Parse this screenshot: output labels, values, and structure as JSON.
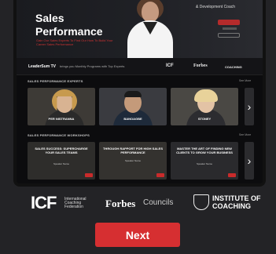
{
  "hero": {
    "title_line1": "Sales",
    "title_line2": "Performance",
    "subtitle": "& Development Coach",
    "description": "Gain Our Sales Experts To Find Our How To Build Your Career Sales Performance"
  },
  "partner_bar": {
    "brand": "LeaderSum TV",
    "tagline": "brings you Monthly Programs with Top Experts",
    "logos": [
      "ICF",
      "Forbes",
      "COACHING"
    ]
  },
  "experts": {
    "section_label": "SALES PERFORMANCE EXPERTS",
    "see_all": "See More",
    "cards": [
      {
        "name": "PER NISTRANNA"
      },
      {
        "name": "BANOAGBE"
      },
      {
        "name": "STONEY"
      }
    ]
  },
  "workshops": {
    "section_label": "SALES PERFORMANCE WORKSHOPS",
    "see_all": "See More",
    "cards": [
      {
        "title": "SALES SUCCESS: SUPERCHARGE YOUR SALES TEAMS",
        "sub": "Speaker Name"
      },
      {
        "title": "THROUGH RAPPORT FOR HIGH SALES PERFORMANCE",
        "sub": "Speaker Name"
      },
      {
        "title": "MASTER THE ART OF FINDING NEW CLIENTS TO GROW YOUR BUSINESS",
        "sub": "Speaker Name"
      }
    ]
  },
  "footer_logos": {
    "icf": "ICF",
    "icf_sub_1": "International",
    "icf_sub_2": "Coaching",
    "icf_sub_3": "Federation",
    "forbes": "Forbes",
    "councils": "Councils",
    "ioc_line1": "INSTITUTE OF",
    "ioc_line2": "COACHING"
  },
  "next_button": {
    "label": "Next"
  },
  "colors": {
    "accent": "#d62f31",
    "background": "#232326"
  }
}
